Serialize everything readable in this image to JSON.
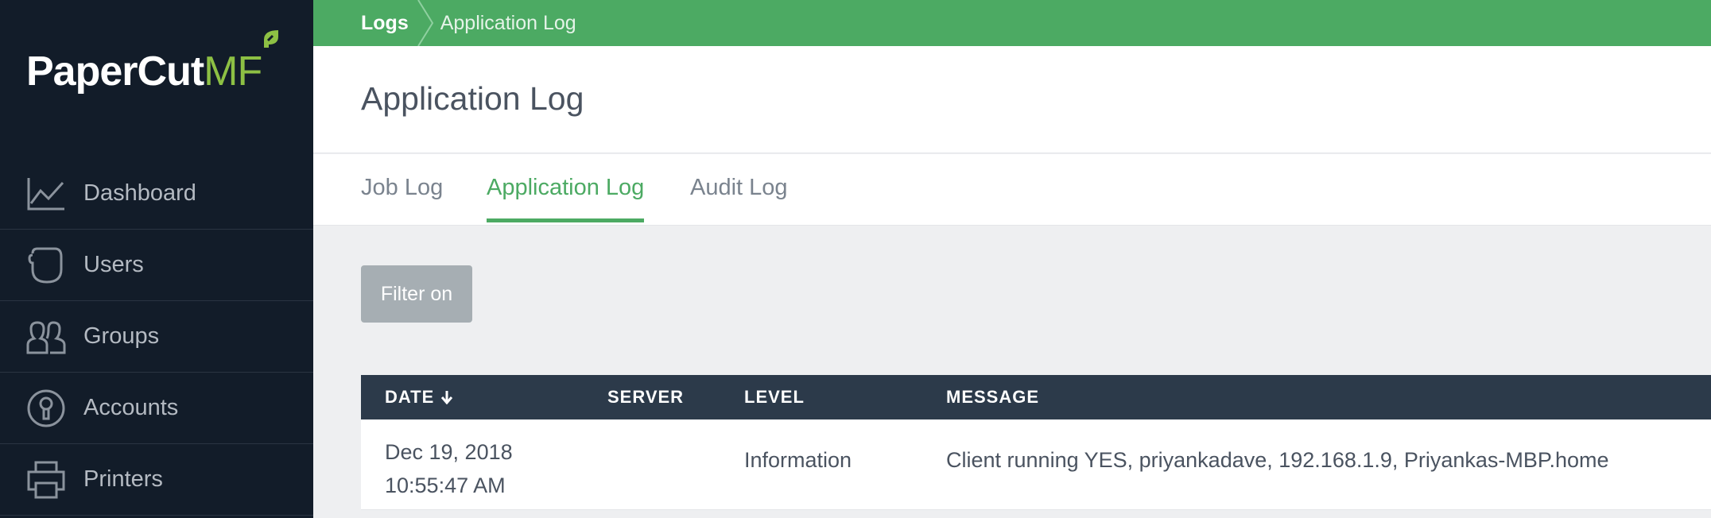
{
  "brand": {
    "name_main": "PaperCut",
    "name_suffix": "MF",
    "accent_color": "#8dc044"
  },
  "sidebar": {
    "items": [
      {
        "label": "Dashboard",
        "icon": "chart-line-icon"
      },
      {
        "label": "Users",
        "icon": "user-icon"
      },
      {
        "label": "Groups",
        "icon": "group-icon"
      },
      {
        "label": "Accounts",
        "icon": "account-icon"
      },
      {
        "label": "Printers",
        "icon": "printer-icon"
      }
    ]
  },
  "breadcrumb": {
    "items": [
      "Logs",
      "Application Log"
    ]
  },
  "page": {
    "title": "Application Log"
  },
  "tabs": [
    {
      "label": "Job Log",
      "active": false
    },
    {
      "label": "Application Log",
      "active": true
    },
    {
      "label": "Audit Log",
      "active": false
    }
  ],
  "filter": {
    "button_label": "Filter on"
  },
  "table": {
    "columns": [
      "DATE",
      "SERVER",
      "LEVEL",
      "MESSAGE"
    ],
    "sort_column": "DATE",
    "sort_direction": "descending",
    "rows": [
      {
        "date": "Dec 19, 2018",
        "time": "10:55:47 AM",
        "server": "",
        "level": "Information",
        "message": "Client running YES, priyankadave, 192.168.1.9, Priyankas-MBP.home"
      }
    ]
  },
  "colors": {
    "sidebar_bg": "#121c29",
    "topbar_green": "#4caa63",
    "table_header_bg": "#2c3a4a",
    "filter_button_bg": "#a6aeb3"
  }
}
